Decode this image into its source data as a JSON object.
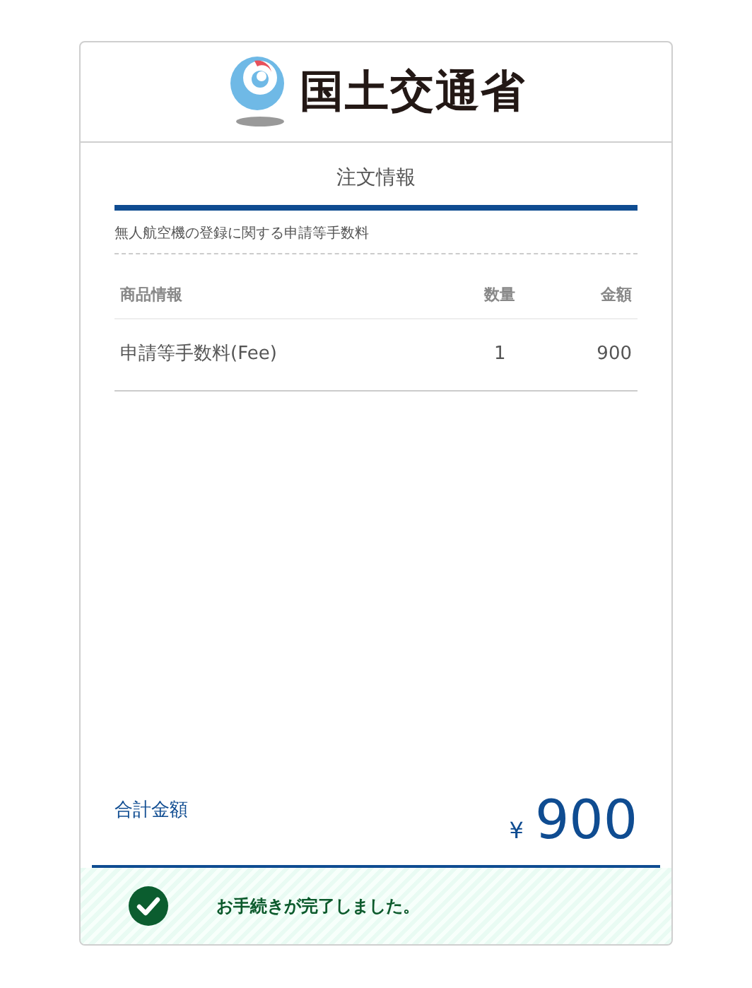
{
  "header": {
    "logo_text": "国土交通省"
  },
  "section_title": "注文情報",
  "description": "無人航空機の登録に関する申請等手数料",
  "table": {
    "columns": [
      "商品情報",
      "数量",
      "金額"
    ],
    "rows": [
      [
        "申請等手数料(Fee)",
        "1",
        "900"
      ]
    ]
  },
  "total": {
    "label": "合計金額",
    "currency": "¥",
    "amount": "900"
  },
  "alert": {
    "message": "お手続きが完了しました。"
  }
}
